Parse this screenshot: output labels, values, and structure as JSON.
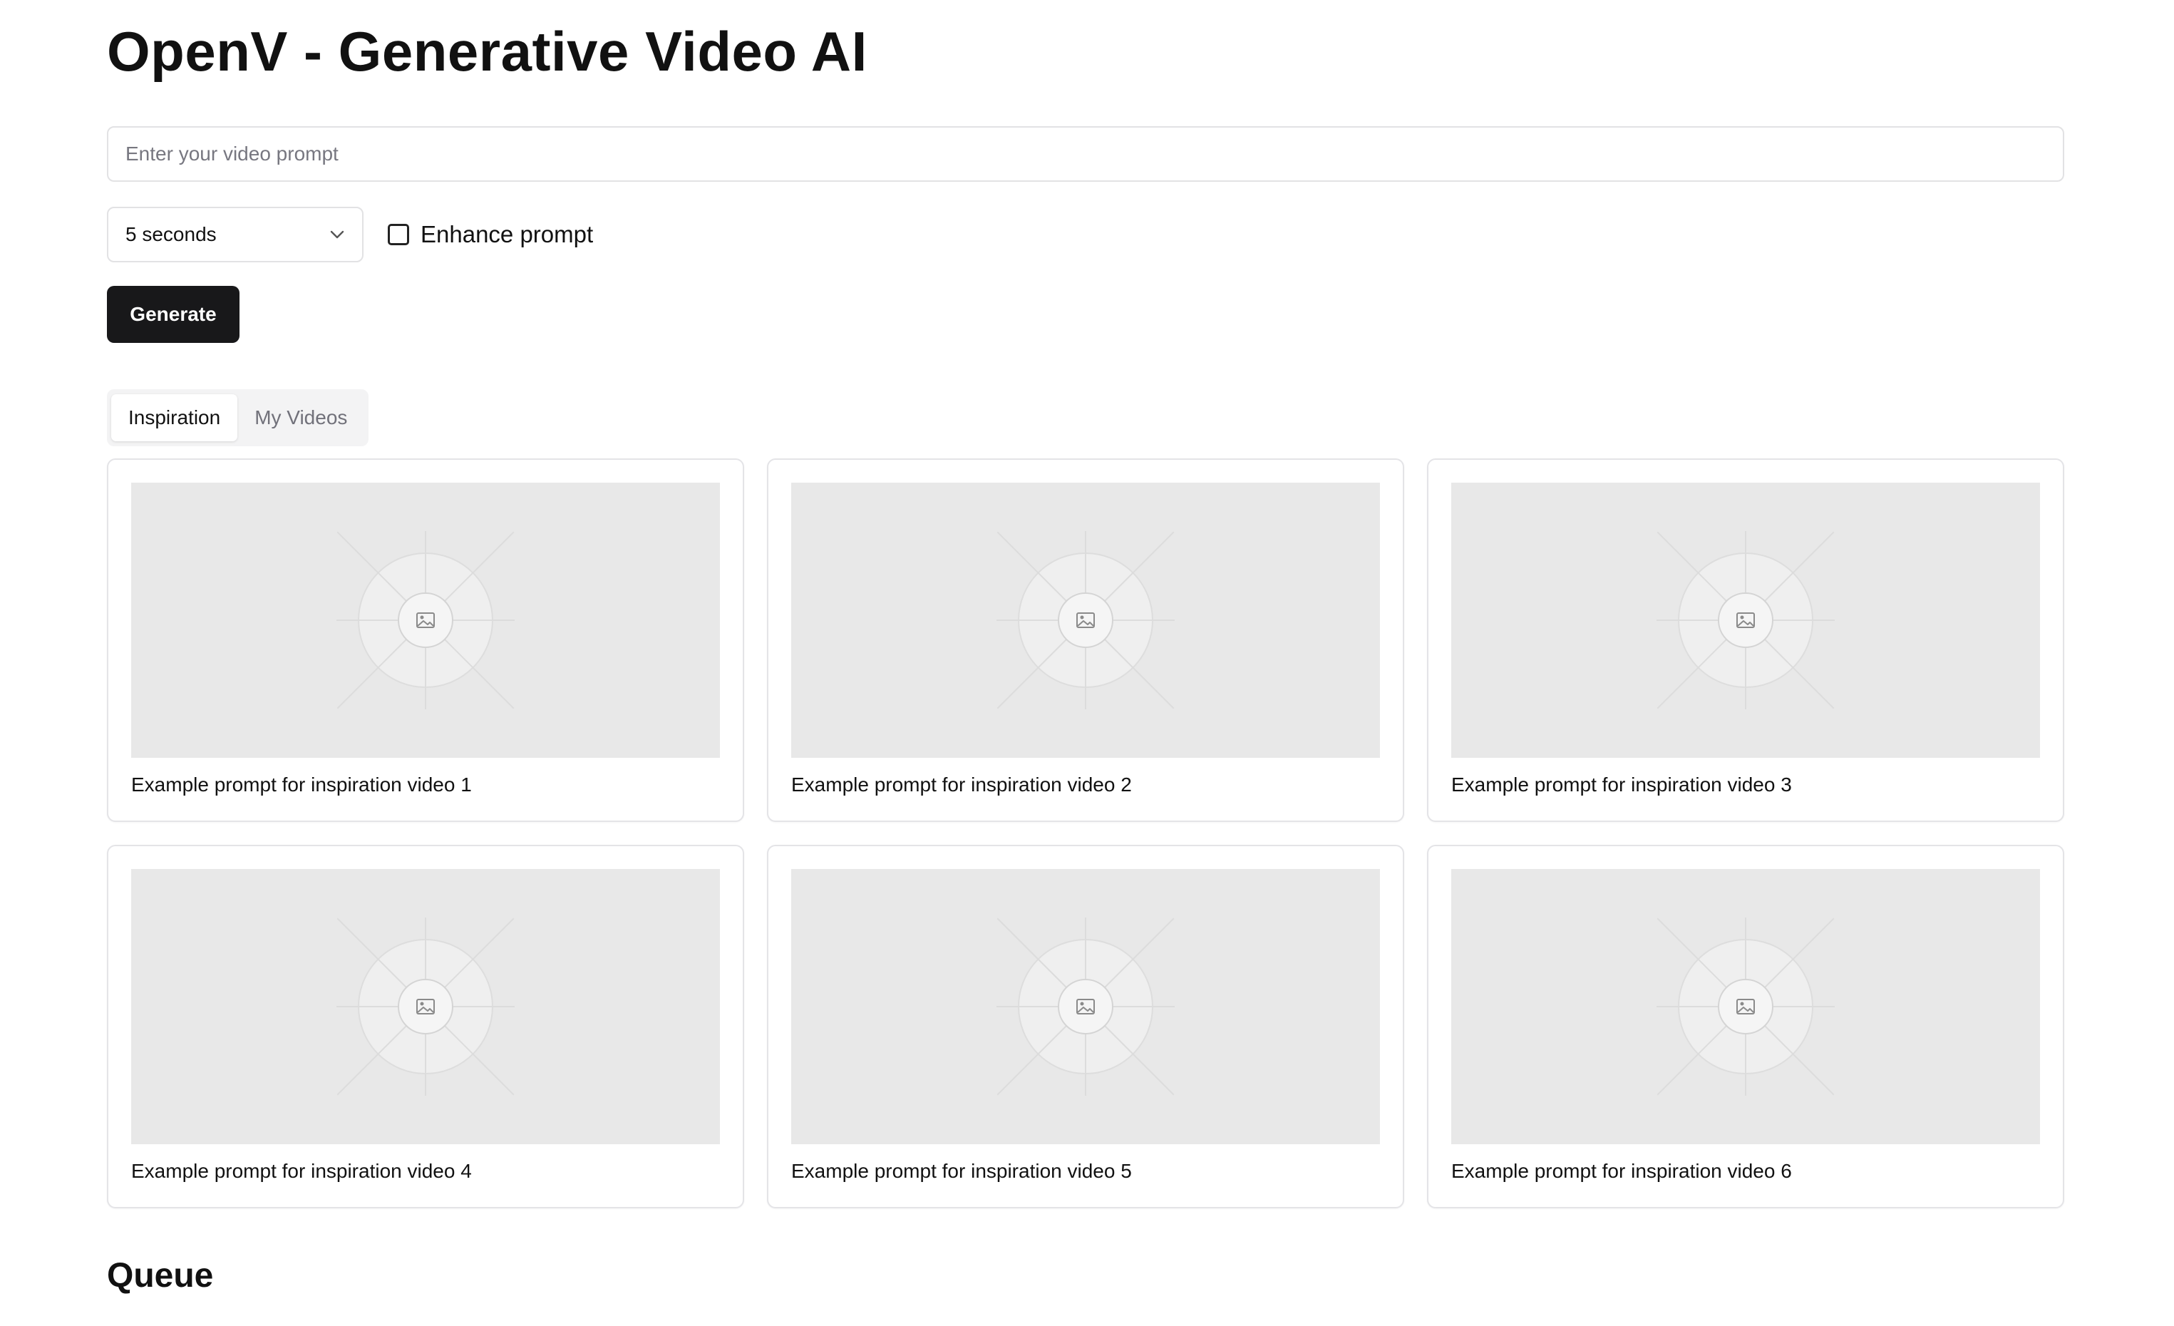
{
  "header": {
    "title": "OpenV - Generative Video AI"
  },
  "prompt": {
    "placeholder": "Enter your video prompt",
    "value": ""
  },
  "duration_select": {
    "selected": "5 seconds"
  },
  "enhance": {
    "label": "Enhance prompt",
    "checked": false
  },
  "generate_label": "Generate",
  "tabs": [
    {
      "label": "Inspiration",
      "active": true
    },
    {
      "label": "My Videos",
      "active": false
    }
  ],
  "inspiration": [
    {
      "caption": "Example prompt for inspiration video 1"
    },
    {
      "caption": "Example prompt for inspiration video 2"
    },
    {
      "caption": "Example prompt for inspiration video 3"
    },
    {
      "caption": "Example prompt for inspiration video 4"
    },
    {
      "caption": "Example prompt for inspiration video 5"
    },
    {
      "caption": "Example prompt for inspiration video 6"
    }
  ],
  "queue": {
    "title": "Queue"
  },
  "icons": {
    "thumbnail": "image-placeholder-icon",
    "select": "chevron-down-icon"
  }
}
